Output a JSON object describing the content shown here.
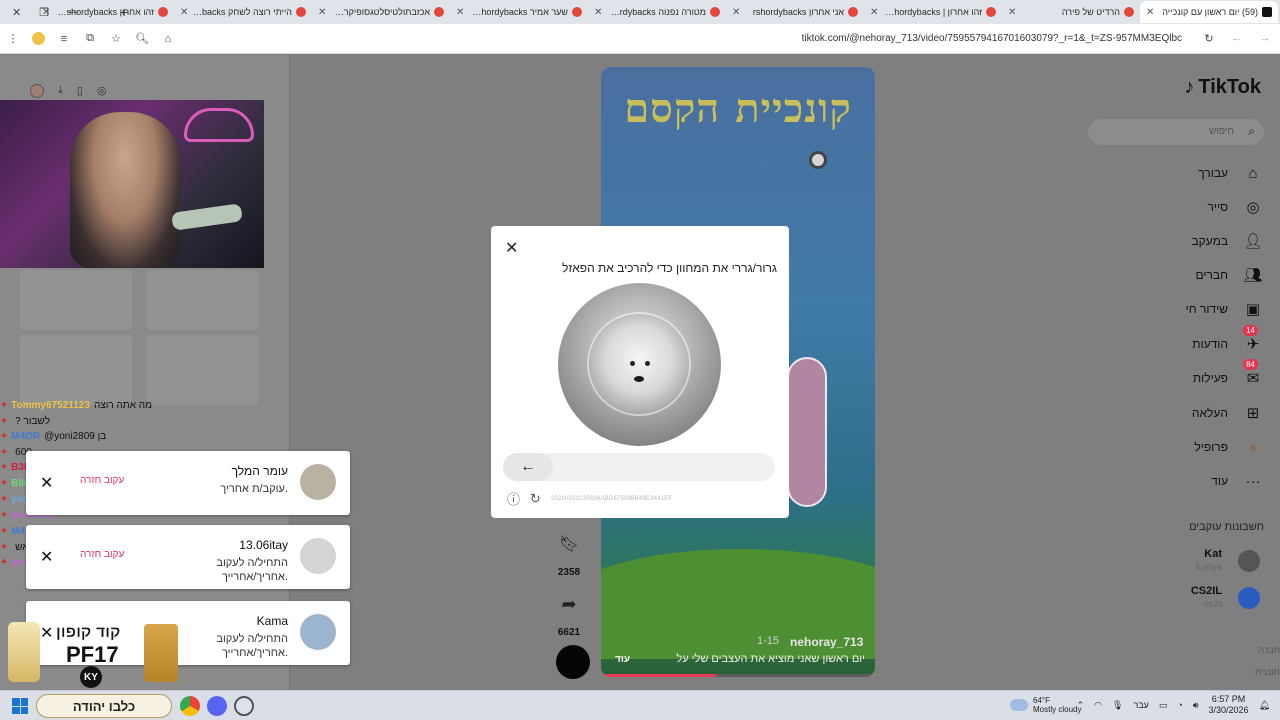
{
  "browser": {
    "tabs": [
      {
        "title": "(59) יום ראשון עם קונכייה",
        "active": true,
        "favicon": "tiktok"
      },
      {
        "title": "הרדיט של פירה",
        "active": false,
        "favicon": "reddit"
      },
      {
        "title": "זהו אחרון | r/theshordybacks",
        "active": false,
        "favicon": "reddit"
      },
      {
        "title": "אני אחרון rshordybacks",
        "active": false,
        "favicon": "reddit"
      },
      {
        "title": "מטורה נפנוה eshordybacks",
        "active": false,
        "favicon": "reddit"
      },
      {
        "title": "שער אמיר r/theshordybacks",
        "active": false,
        "favicon": "reddit"
      },
      {
        "title": "אכזבתולטיסלטגסופיקרמגה",
        "active": false,
        "favicon": "reddit"
      },
      {
        "title": "הייתי רוצה לשחק rdybacks",
        "active": false,
        "favicon": "reddit"
      },
      {
        "title": "זהו אחרון r/theshordybacks",
        "active": false,
        "favicon": "reddit"
      }
    ],
    "url": "tiktok.com/@nehoray_713/video/7595579416701603079?_r=1&_t=ZS-957MM3EQlbc"
  },
  "tiktok": {
    "logo": "TikTok",
    "search_placeholder": "חיפוש",
    "nav": [
      {
        "label": "עבורך",
        "icon": "home-icon"
      },
      {
        "label": "סייר",
        "icon": "compass-icon"
      },
      {
        "label": "במעקב",
        "icon": "following-icon"
      },
      {
        "label": "חברים",
        "icon": "friends-icon"
      },
      {
        "label": "שידור חי",
        "icon": "live-icon"
      },
      {
        "label": "הודעות",
        "icon": "messages-icon",
        "badge": "14"
      },
      {
        "label": "פעילות",
        "icon": "activity-icon",
        "badge": "84"
      },
      {
        "label": "העלאה",
        "icon": "upload-icon"
      },
      {
        "label": "פרופיל",
        "icon": "profile-icon"
      },
      {
        "label": "עוד",
        "icon": "more-icon"
      }
    ],
    "following_title": "חשבונות עוקבים",
    "following_accounts": [
      {
        "name": "Kat",
        "handle": "k.atiya"
      },
      {
        "name": "CS2IL",
        "handle": "cs2il"
      }
    ],
    "footer": [
      "חברה",
      "תוכנית"
    ]
  },
  "video": {
    "title_art": "קונכיית הקסם",
    "handle": "nehoray_713",
    "range": "1-15",
    "caption": "יום ראשון שאני מוציא את העצבים שלי על",
    "more": "עוד",
    "progress": 0.42,
    "actions": [
      {
        "icon": "bookmark-icon",
        "count": "2358"
      },
      {
        "icon": "share-icon",
        "count": "6621"
      }
    ]
  },
  "captcha": {
    "instruction": "גרור/גררי את המחוון כדי להרכיב את הפאזל",
    "code": "202b0333235636ABD875096B48E3441EF"
  },
  "stream": {
    "chat": [
      {
        "name": "Tommy67521123",
        "text": "מה אתה רוצה",
        "color": "#f0c24a"
      },
      {
        "name": "",
        "text": "? לשבור",
        "color": "#222222"
      },
      {
        "name": "M4OR",
        "text": "@yoni2809 בן",
        "color": "#3f7bd1"
      },
      {
        "name": "",
        "text": "600",
        "color": "#222222"
      },
      {
        "name": "B3Rhayde",
        "text": "",
        "color": "#d0204a"
      },
      {
        "name": "Blinki_Stw",
        "text": "",
        "color": "#6fd67a"
      },
      {
        "name": "yoni2809",
        "text": "",
        "color": "#6fa6e0"
      },
      {
        "name": "pishoto1",
        "text": "",
        "color": "#b96ad0"
      },
      {
        "name": "M4OR",
        "text": "",
        "color": "#3f7bd1"
      },
      {
        "name": "",
        "text": "וואלה כן היה אש",
        "color": "#222222"
      },
      {
        "name": "pishoto1",
        "text": "",
        "color": "#b96ad0"
      }
    ],
    "follows": [
      {
        "name": "עומר המלך",
        "sub": ".עוקב/ת אחריך",
        "undo": "עקוב חזרה"
      },
      {
        "name": "13.06itay",
        "sub": "התחיל/ה לעקוב\n.אחריך/אחרייך",
        "undo": "עקוב חזרה"
      },
      {
        "name": "Kama",
        "sub": "התחיל/ה לעקוב\n.אחריך/אחרייך",
        "undo": ""
      }
    ],
    "promo_code_label": "קוד קופון",
    "promo_code": "PF17",
    "ticker": "כלבו יהודה"
  },
  "taskbar": {
    "weather_temp": "64°F",
    "weather_desc": "Mostly cloudy",
    "lang": "עבר",
    "time": "6:57 PM",
    "date": "3/30/2026"
  }
}
